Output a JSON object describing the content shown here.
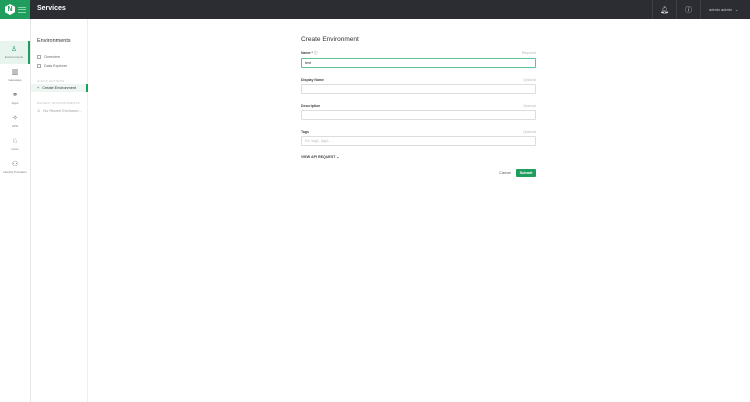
{
  "header": {
    "logo_letter": "N",
    "title": "Services",
    "user": "admin admin"
  },
  "rail": [
    {
      "label": "Environments",
      "icon": "bell-icon",
      "glyph": "♙"
    },
    {
      "label": "Gateways",
      "icon": "gateway-icon",
      "glyph": "▥"
    },
    {
      "label": "Apps",
      "icon": "apps-icon",
      "glyph": "⚭"
    },
    {
      "label": "APIs",
      "icon": "api-icon",
      "glyph": "✧"
    },
    {
      "label": "Certs",
      "icon": "certificate-icon",
      "glyph": "♘"
    },
    {
      "label": "Identity Providers",
      "icon": "identity-icon",
      "glyph": "⚇"
    }
  ],
  "panel": {
    "title": "Environments",
    "items": [
      "Overview",
      "Data Explorer"
    ],
    "quick_actions": "QUICK ACTIONS",
    "create": "Create Environment",
    "recent": "RECENT ENVIRONMENTS",
    "no_recent": "No Recent Environm..."
  },
  "form": {
    "title": "Create Environment",
    "name": {
      "label": "Name *",
      "hint": "Required",
      "value": "test"
    },
    "display_name": {
      "label": "Display Name",
      "hint": "Optional",
      "value": ""
    },
    "description": {
      "label": "Description",
      "hint": "Optional",
      "value": ""
    },
    "tags": {
      "label": "Tags",
      "hint": "Optional",
      "placeholder": "Ex: tag1, tag2, ..."
    },
    "api_request": "VIEW API REQUEST",
    "cancel": "Cancel",
    "submit": "Submit"
  },
  "colors": {
    "accent": "#1f9d5c",
    "topbar": "#2b2d33"
  }
}
